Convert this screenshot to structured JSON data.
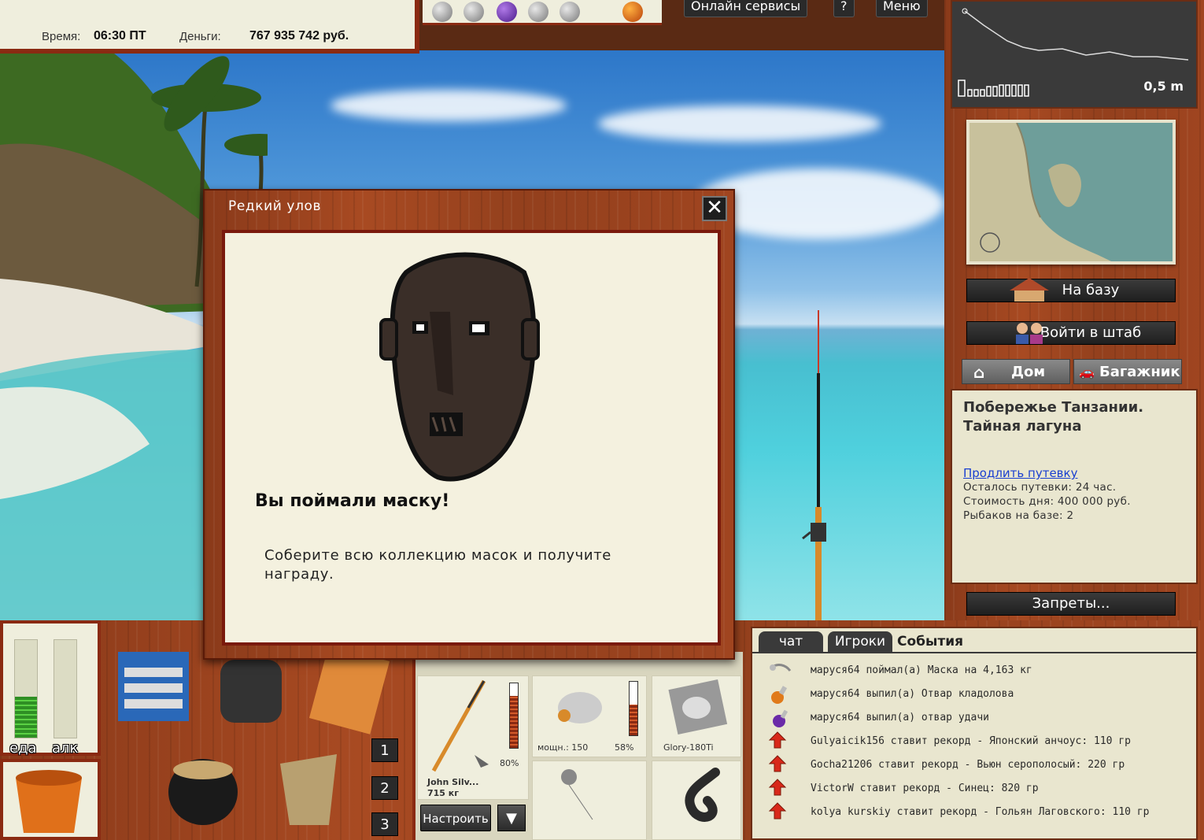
{
  "status": {
    "time_label": "Время:",
    "time_value": "06:30 ПТ",
    "money_label": "Деньги:",
    "money_value": "767 935 742 руб."
  },
  "top_buttons": {
    "online": "Онлайн сервисы",
    "help": "?",
    "menu": "Меню"
  },
  "depth": {
    "value": "0,5 m"
  },
  "right_panel": {
    "to_base": "На базу",
    "enter_hq": "Войти в штаб",
    "home_tab": "Дом",
    "trunk_tab": "Багажник",
    "bans_button": "Запреты..."
  },
  "location": {
    "title": "Побережье Танзании.\nТайная лагуна",
    "extend_link": "Продлить путевку",
    "remaining": "Осталось путевки: 24 час.",
    "day_cost": "Стоимость дня: 400 000 руб.",
    "fishers": "Рыбаков на базе: 2"
  },
  "meters": {
    "food_label": "еда",
    "alc_label": "алк",
    "food_level": 0.42,
    "alc_level": 0.0
  },
  "slots": [
    "1",
    "2",
    "3"
  ],
  "tackle": {
    "rod_percent": "80%",
    "rod_name": "John Silv...",
    "rod_weight": "715 кг",
    "reel_power": "мощн.: 150",
    "reel_percent": "58%",
    "line_name": "Glory-180Ti",
    "rod_level": 0.8,
    "reel_level": 0.58,
    "setup_button": "Настроить",
    "arrow": "▼"
  },
  "chat": {
    "tabs": [
      "чат",
      "Игроки",
      "События"
    ],
    "events": [
      {
        "icon": "mask-icon",
        "text": "маруся64 поймал(а) Маска на 4,163 кг"
      },
      {
        "icon": "potion-orange-icon",
        "text": "маруся64 выпил(а) Отвар кладолова"
      },
      {
        "icon": "potion-purple-icon",
        "text": "маруся64 выпил(а) отвар удачи"
      },
      {
        "icon": "record-arrow-icon",
        "text": "Gulyaicik156 ставит рекорд - Японский анчоус: 110 гр"
      },
      {
        "icon": "record-arrow-icon",
        "text": "Gocha21206 ставит рекорд - Вьюн серополосый: 220 гр"
      },
      {
        "icon": "record-arrow-icon",
        "text": "VictorW ставит рекорд - Синец: 820 гр"
      },
      {
        "icon": "record-arrow-icon",
        "text": "kolya kurskiy ставит рекорд - Гольян Лаговского: 110 гр"
      }
    ]
  },
  "modal": {
    "title": "Редкий улов",
    "close": "✕",
    "catch_text": "Вы поймали маску!",
    "description": "Соберите всю коллекцию масок и получите награду."
  },
  "colors": {
    "wood_frame": "#8a2a12",
    "panel_bg": "#efeedd",
    "link": "#1a3fd0"
  }
}
